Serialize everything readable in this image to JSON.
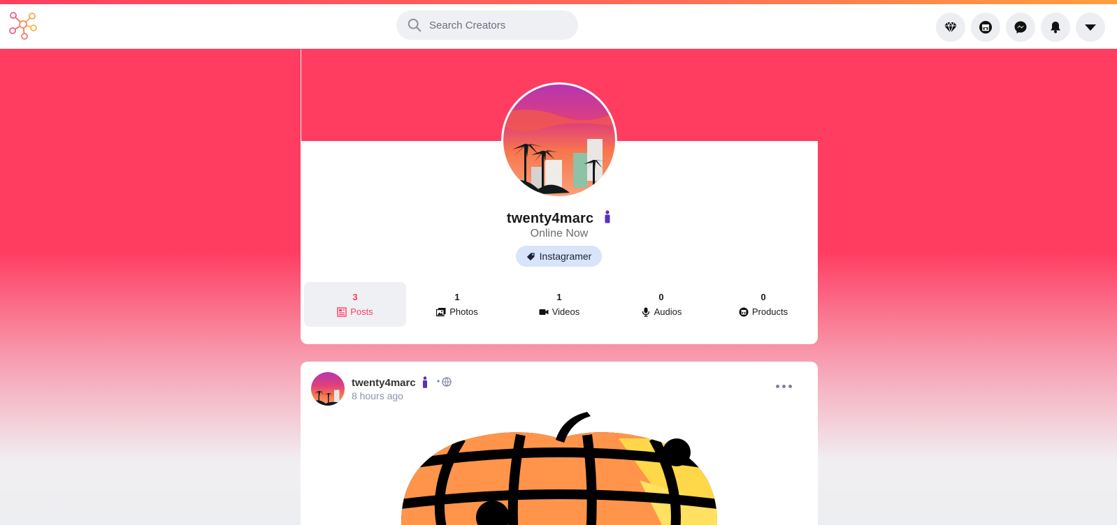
{
  "header": {
    "search_placeholder": "Search Creators",
    "icons": [
      "diamond-icon",
      "store-icon",
      "messenger-icon",
      "bell-icon",
      "chevron-down-icon"
    ]
  },
  "profile": {
    "username": "twenty4marc",
    "status": "Online Now",
    "category": "Instagramer",
    "tabs": [
      {
        "count": "3",
        "label": "Posts",
        "icon": "posts-icon"
      },
      {
        "count": "1",
        "label": "Photos",
        "icon": "photos-icon"
      },
      {
        "count": "1",
        "label": "Videos",
        "icon": "video-icon"
      },
      {
        "count": "0",
        "label": "Audios",
        "icon": "microphone-icon"
      },
      {
        "count": "0",
        "label": "Products",
        "icon": "store-icon"
      }
    ]
  },
  "post": {
    "author": "twenty4marc",
    "separator": "•",
    "time": "8 hours ago"
  },
  "colors": {
    "accent": "#ff3d61",
    "active_tab_bg": "#eef0f4",
    "pill_bg": "#d8e4fb",
    "badge_purple": "#5b2fbf"
  }
}
